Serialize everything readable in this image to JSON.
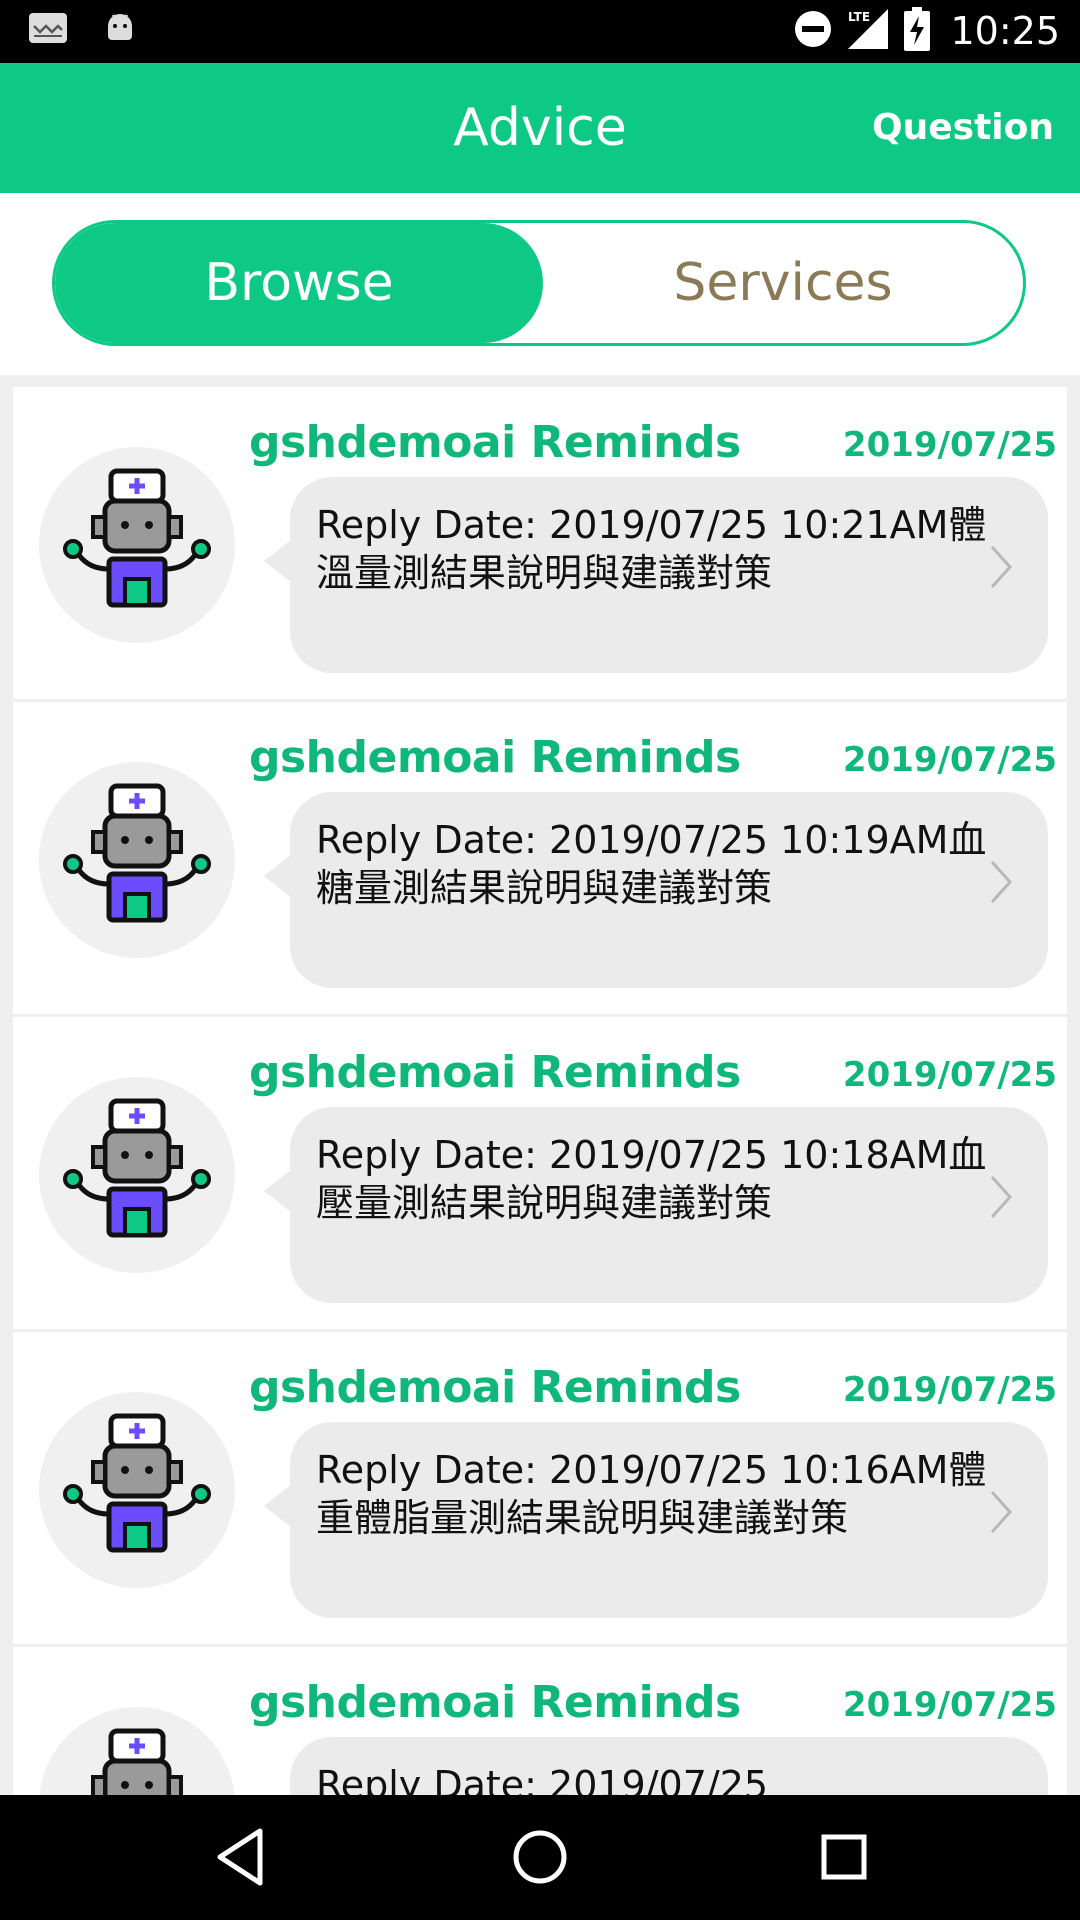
{
  "status_bar": {
    "time": "10:25",
    "network": "LTE",
    "icons": [
      "notification-icon",
      "android-icon",
      "dnd-icon",
      "lte-signal-icon",
      "battery-charging-icon"
    ]
  },
  "app_bar": {
    "title": "Advice",
    "action": "Question"
  },
  "tabs": {
    "browse": "Browse",
    "services": "Services",
    "selected": "Browse"
  },
  "messages": [
    {
      "sender": "gshdemoai Reminds",
      "date": "2019/07/25",
      "text": "Reply Date: 2019/07/25 10:21AM體溫量測結果說明與建議對策"
    },
    {
      "sender": "gshdemoai Reminds",
      "date": "2019/07/25",
      "text": "Reply Date: 2019/07/25 10:19AM血糖量測結果說明與建議對策"
    },
    {
      "sender": "gshdemoai Reminds",
      "date": "2019/07/25",
      "text": "Reply Date: 2019/07/25 10:18AM血壓量測結果說明與建議對策"
    },
    {
      "sender": "gshdemoai Reminds",
      "date": "2019/07/25",
      "text": "Reply Date: 2019/07/25 10:16AM體重體脂量測結果說明與建議對策"
    },
    {
      "sender": "gshdemoai Reminds",
      "date": "2019/07/25",
      "text": "Reply Date: 2019/07/25"
    }
  ],
  "colors": {
    "accent": "#0dc985",
    "sender_text": "#0fb77a",
    "services_text": "#8a7a56",
    "bubble": "#ebebeb"
  },
  "nav_bar": {
    "icons": [
      "back-icon",
      "home-icon",
      "recents-icon"
    ]
  }
}
